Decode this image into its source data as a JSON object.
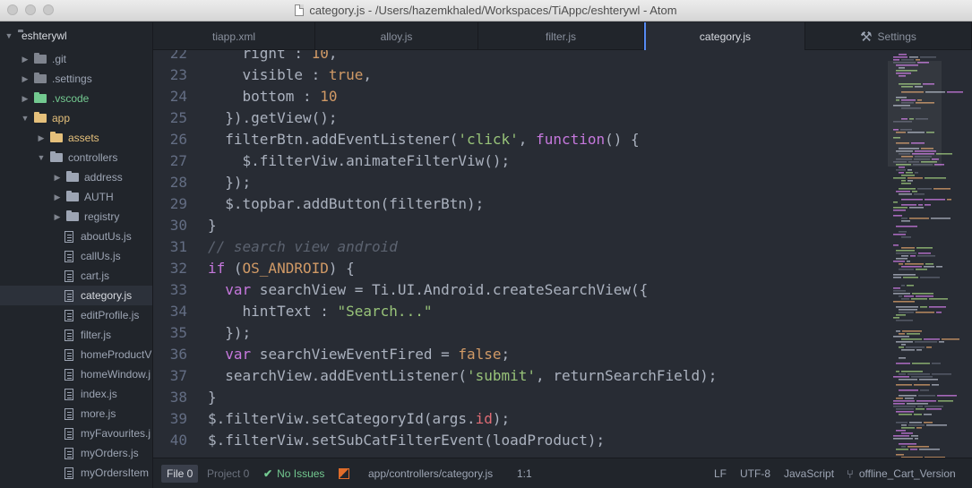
{
  "window": {
    "title": "category.js - /Users/hazemkhaled/Workspaces/TiAppc/eshterywl - Atom"
  },
  "sidebar": {
    "root": "eshterywl",
    "items": [
      {
        "label": ".git",
        "type": "folder",
        "color": "#7f848e",
        "expanded": false,
        "depth": 1
      },
      {
        "label": ".settings",
        "type": "folder",
        "color": "#7f848e",
        "expanded": false,
        "depth": 1
      },
      {
        "label": ".vscode",
        "type": "folder",
        "color": "#73c990",
        "expanded": false,
        "depth": 1
      },
      {
        "label": "app",
        "type": "folder",
        "color": "#e5c07b",
        "expanded": true,
        "depth": 1
      },
      {
        "label": "assets",
        "type": "folder",
        "color": "#e5c07b",
        "expanded": false,
        "depth": 2
      },
      {
        "label": "controllers",
        "type": "folder",
        "color": "#9da5b4",
        "expanded": true,
        "depth": 2
      },
      {
        "label": "address",
        "type": "folder",
        "color": "#9da5b4",
        "expanded": false,
        "depth": 3
      },
      {
        "label": "AUTH",
        "type": "folder",
        "color": "#9da5b4",
        "expanded": false,
        "depth": 3
      },
      {
        "label": "registry",
        "type": "folder",
        "color": "#9da5b4",
        "expanded": false,
        "depth": 3
      },
      {
        "label": "aboutUs.js",
        "type": "file",
        "depth": 3
      },
      {
        "label": "callUs.js",
        "type": "file",
        "depth": 3
      },
      {
        "label": "cart.js",
        "type": "file",
        "depth": 3
      },
      {
        "label": "category.js",
        "type": "file",
        "depth": 3,
        "selected": true
      },
      {
        "label": "editProfile.js",
        "type": "file",
        "depth": 3
      },
      {
        "label": "filter.js",
        "type": "file",
        "depth": 3
      },
      {
        "label": "homeProductV",
        "type": "file",
        "depth": 3
      },
      {
        "label": "homeWindow.j",
        "type": "file",
        "depth": 3
      },
      {
        "label": "index.js",
        "type": "file",
        "depth": 3
      },
      {
        "label": "more.js",
        "type": "file",
        "depth": 3
      },
      {
        "label": "myFavourites.j",
        "type": "file",
        "depth": 3
      },
      {
        "label": "myOrders.js",
        "type": "file",
        "depth": 3
      },
      {
        "label": "myOrdersItem",
        "type": "file",
        "depth": 3
      }
    ]
  },
  "tabs": [
    {
      "label": "tiapp.xml",
      "active": false
    },
    {
      "label": "alloy.js",
      "active": false
    },
    {
      "label": "filter.js",
      "active": false
    },
    {
      "label": "category.js",
      "active": true
    },
    {
      "label": "Settings",
      "active": false,
      "icon": "wrench-icon"
    }
  ],
  "editor": {
    "lines": [
      {
        "n": "22",
        "tokens": [
          [
            "    right : ",
            ""
          ],
          [
            "10",
            "n"
          ],
          [
            ",",
            ""
          ]
        ]
      },
      {
        "n": "23",
        "tokens": [
          [
            "    visible : ",
            ""
          ],
          [
            "true",
            "n"
          ],
          [
            ",",
            ""
          ]
        ]
      },
      {
        "n": "24",
        "tokens": [
          [
            "    bottom : ",
            ""
          ],
          [
            "10",
            "n"
          ]
        ]
      },
      {
        "n": "25",
        "tokens": [
          [
            "  }).getView();",
            ""
          ]
        ]
      },
      {
        "n": "26",
        "tokens": [
          [
            "  filterBtn.addEventListener(",
            ""
          ],
          [
            "'click'",
            "s"
          ],
          [
            ", ",
            ""
          ],
          [
            "function",
            "k"
          ],
          [
            "() {",
            ""
          ]
        ]
      },
      {
        "n": "27",
        "tokens": [
          [
            "    $.filterViw.animateFilterViw();",
            ""
          ]
        ]
      },
      {
        "n": "28",
        "tokens": [
          [
            "  });",
            ""
          ]
        ]
      },
      {
        "n": "29",
        "tokens": [
          [
            "  $.topbar.addButton(filterBtn);",
            ""
          ]
        ]
      },
      {
        "n": "30",
        "tokens": [
          [
            "}",
            ""
          ]
        ]
      },
      {
        "n": "31",
        "tokens": [
          [
            "// search view android",
            "c"
          ]
        ]
      },
      {
        "n": "32",
        "tokens": [
          [
            "if",
            "k"
          ],
          [
            " (",
            ""
          ],
          [
            "OS_ANDROID",
            "n"
          ],
          [
            ") {",
            ""
          ]
        ]
      },
      {
        "n": "33",
        "tokens": [
          [
            "  ",
            ""
          ],
          [
            "var",
            "k"
          ],
          [
            " searchView = Ti.UI.Android.createSearchView({",
            ""
          ]
        ]
      },
      {
        "n": "34",
        "tokens": [
          [
            "    hintText : ",
            ""
          ],
          [
            "\"Search...\"",
            "s"
          ]
        ]
      },
      {
        "n": "35",
        "tokens": [
          [
            "  });",
            ""
          ]
        ]
      },
      {
        "n": "36",
        "tokens": [
          [
            "  ",
            ""
          ],
          [
            "var",
            "k"
          ],
          [
            " searchViewEventFired = ",
            ""
          ],
          [
            "false",
            "n"
          ],
          [
            ";",
            ""
          ]
        ]
      },
      {
        "n": "37",
        "tokens": [
          [
            "  searchView.addEventListener(",
            ""
          ],
          [
            "'submit'",
            "s"
          ],
          [
            ", returnSearchField);",
            ""
          ]
        ]
      },
      {
        "n": "38",
        "tokens": [
          [
            "}",
            ""
          ]
        ]
      },
      {
        "n": "39",
        "tokens": [
          [
            "$.filterViw.setCategoryId(args.",
            ""
          ],
          [
            "id",
            "p"
          ],
          [
            ");",
            ""
          ]
        ]
      },
      {
        "n": "40",
        "tokens": [
          [
            "$.filterViw.setSubCatFilterEvent(loadProduct);",
            ""
          ]
        ]
      }
    ]
  },
  "status": {
    "file_tab": "File 0",
    "project_tab": "Project 0",
    "issues": "No Issues",
    "path": "app/controllers/category.js",
    "cursor": "1:1",
    "line_ending": "LF",
    "encoding": "UTF-8",
    "grammar": "JavaScript",
    "branch": "offline_Cart_Version"
  }
}
